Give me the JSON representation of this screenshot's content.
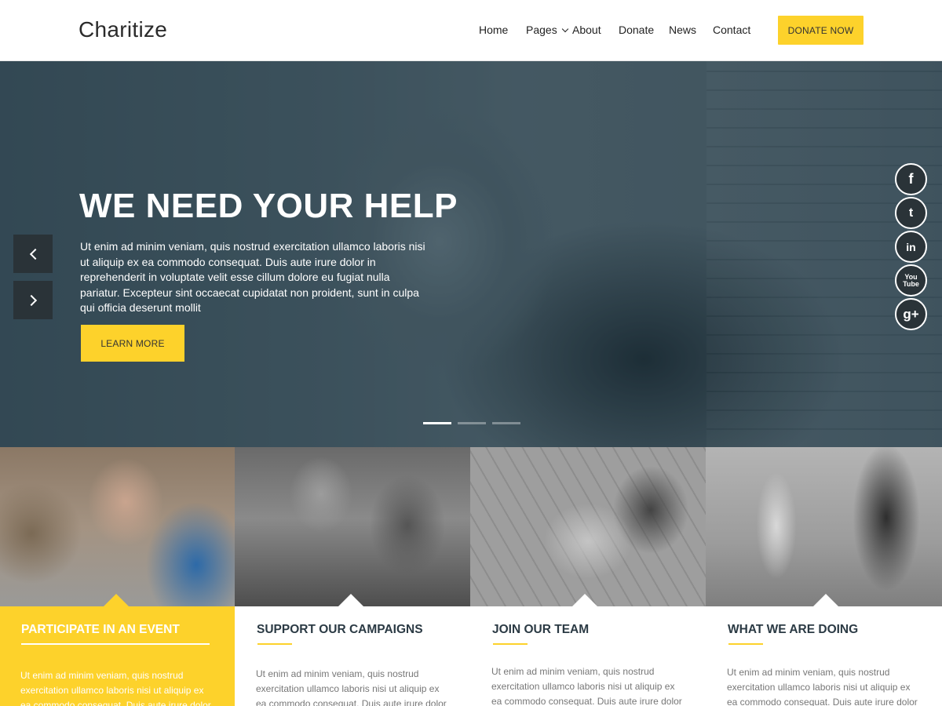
{
  "header": {
    "logo": "Charitize",
    "nav": [
      "Home",
      "Pages",
      "About",
      "Donate",
      "News",
      "Contact"
    ],
    "cta": "DONATE NOW"
  },
  "hero": {
    "title": "WE NEED YOUR HELP",
    "text": "Ut enim ad minim veniam, quis nostrud exercitation ullamco laboris nisi ut aliquip ex ea commodo consequat. Duis aute irure dolor in reprehenderit in voluptate velit esse cillum dolore eu fugiat nulla pariatur. Excepteur sint occaecat cupidatat non proident, sunt in culpa qui officia deserunt mollit",
    "button": "LEARN MORE",
    "slide_count": 3,
    "active_slide": 1
  },
  "social": {
    "facebook": "f",
    "twitter": "t",
    "linkedin": "in",
    "youtube_top": "You",
    "youtube_bottom": "Tube",
    "googleplus": "g+"
  },
  "cards": [
    {
      "title": "PARTICIPATE IN AN EVENT",
      "text": "Ut enim ad minim veniam, quis nostrud exercitation ullamco laboris nisi ut aliquip ex ea commodo consequat. Duis aute irure dolor in reprehenderit"
    },
    {
      "title": "SUPPORT OUR CAMPAIGNS",
      "text": "Ut enim ad minim veniam, quis nostrud exercitation ullamco laboris nisi ut aliquip ex ea commodo consequat. Duis aute irure dolor in reprehenderit"
    },
    {
      "title": "JOIN OUR TEAM",
      "text": "Ut enim ad minim veniam, quis nostrud exercitation ullamco laboris nisi ut aliquip ex ea commodo consequat. Duis aute irure dolor in reprehenderit"
    },
    {
      "title": "WHAT WE ARE DOING",
      "text": "Ut enim ad minim veniam, quis nostrud exercitation ullamco laboris nisi ut aliquip ex ea commodo consequat. Duis aute irure dolor in reprehenderit"
    }
  ],
  "colors": {
    "accent": "#fdd22b",
    "dark": "#2a3338",
    "heading": "#2b3a44"
  }
}
